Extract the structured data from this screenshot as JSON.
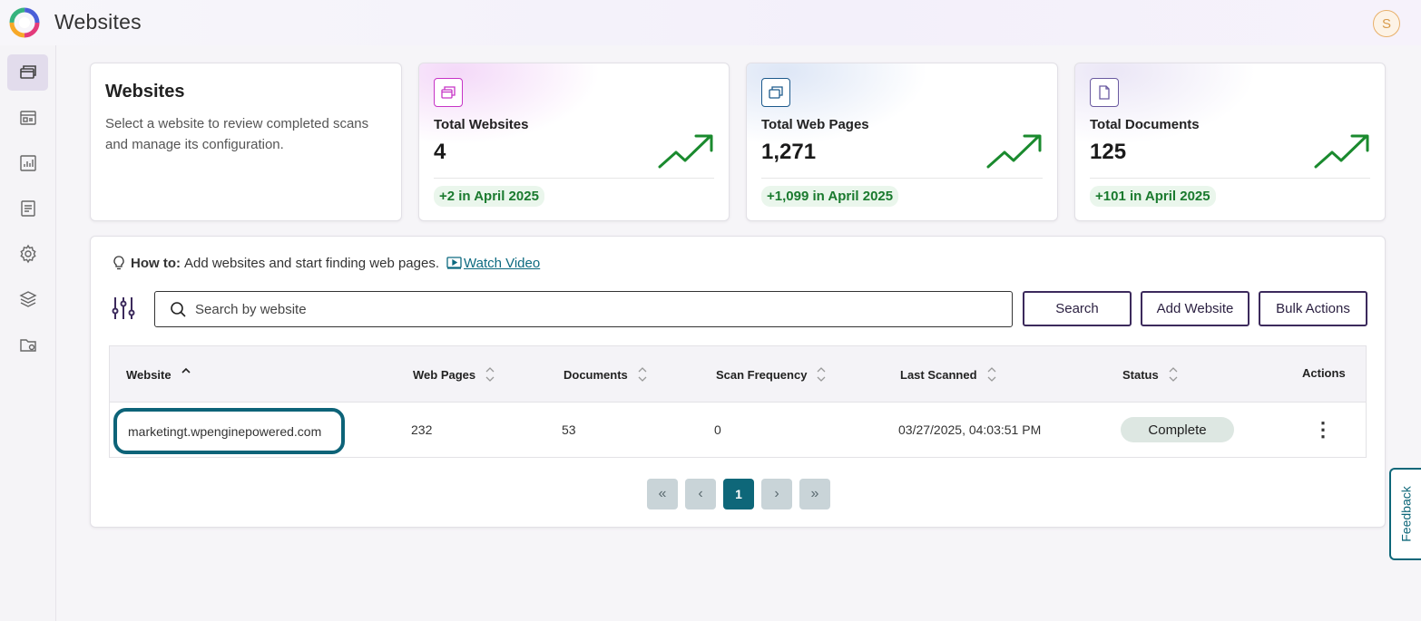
{
  "header": {
    "title": "Websites",
    "avatar_initial": "S"
  },
  "sidebar": {
    "items": [
      {
        "name": "websites",
        "icon": "websites-icon",
        "active": true
      },
      {
        "name": "web-pages",
        "icon": "web-pages-icon",
        "active": false
      },
      {
        "name": "reports",
        "icon": "report-icon",
        "active": false
      },
      {
        "name": "documents",
        "icon": "document-icon",
        "active": false
      },
      {
        "name": "settings",
        "icon": "gear-icon",
        "active": false
      },
      {
        "name": "layers",
        "icon": "layers-icon",
        "active": false
      },
      {
        "name": "folder-settings",
        "icon": "folder-gear-icon",
        "active": false
      }
    ]
  },
  "intro": {
    "title": "Websites",
    "description": "Select a website to review completed scans and manage its configuration."
  },
  "stats": [
    {
      "label": "Total Websites",
      "value": "4",
      "change": "+2 in April 2025",
      "icon": "websites-icon",
      "accent": "#c634c6"
    },
    {
      "label": "Total Web Pages",
      "value": "1,271",
      "change": "+1,099 in April 2025",
      "icon": "web-pages-stack-icon",
      "accent": "#1c5a8c"
    },
    {
      "label": "Total Documents",
      "value": "125",
      "change": "+101 in April 2025",
      "icon": "document-icon",
      "accent": "#6a5aa0"
    }
  ],
  "howto": {
    "prefix": "How to:",
    "text": "Add websites and start finding web pages.",
    "link": "Watch Video"
  },
  "search": {
    "placeholder": "Search by website",
    "value": ""
  },
  "buttons": {
    "search": "Search",
    "add_website": "Add Website",
    "bulk_actions": "Bulk Actions"
  },
  "table": {
    "columns": [
      "Website",
      "Web Pages",
      "Documents",
      "Scan Frequency",
      "Last Scanned",
      "Status",
      "Actions"
    ],
    "rows": [
      {
        "website": "marketingt.wpenginepowered.com",
        "web_pages": "232",
        "documents": "53",
        "scan_frequency": "0",
        "last_scanned": "03/27/2025, 04:03:51 PM",
        "status": "Complete"
      }
    ]
  },
  "pagination": {
    "first": "«",
    "prev": "‹",
    "current": "1",
    "next": "›",
    "last": "»"
  },
  "feedback": "Feedback",
  "colors": {
    "accent": "#0e6779",
    "button_border": "#3c2a5c",
    "positive": "#1a7a2e"
  }
}
